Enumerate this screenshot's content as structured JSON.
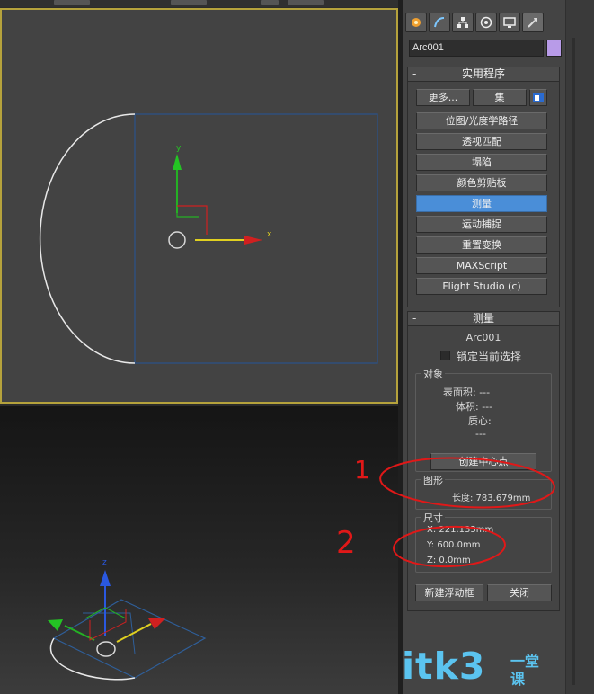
{
  "tabs": [
    "create-icon",
    "modify-icon",
    "hierarchy-icon",
    "motion-icon",
    "display-icon",
    "utilities-icon"
  ],
  "object": {
    "name": "Arc001",
    "color": "#b89be8"
  },
  "utilities": {
    "title": "实用程序",
    "more_label": "更多...",
    "sets_label": "集",
    "items": [
      "位图/光度学路径",
      "透视匹配",
      "塌陷",
      "颜色剪贴板",
      "测量",
      "运动捕捉",
      "重置变换",
      "MAXScript",
      "Flight Studio (c)"
    ],
    "active_index": 4
  },
  "measure": {
    "title": "测量",
    "object_name": "Arc001",
    "lock_label": "锁定当前选择",
    "objects_group": "对象",
    "surface_area": "表面积: ---",
    "volume": "体积: ---",
    "centroid_label": "质心:",
    "centroid_value": "---",
    "create_center_btn": "创建中心点",
    "shapes_group": "图形",
    "length": "长度: 783.679mm",
    "dimensions_group": "尺寸",
    "dim_x": "X:   221.133mm",
    "dim_y": "Y:   600.0mm",
    "dim_z": "Z:   0.0mm",
    "new_floater_btn": "新建浮动框",
    "close_btn": "关闭"
  },
  "gizmo": {
    "x_label": "x",
    "y_label": "y",
    "z_label": "z"
  },
  "annotations": {
    "mark1": "1",
    "mark2": "2"
  },
  "watermark": {
    "main": "itk3",
    "sub1": "一堂",
    "sub2": "课"
  }
}
